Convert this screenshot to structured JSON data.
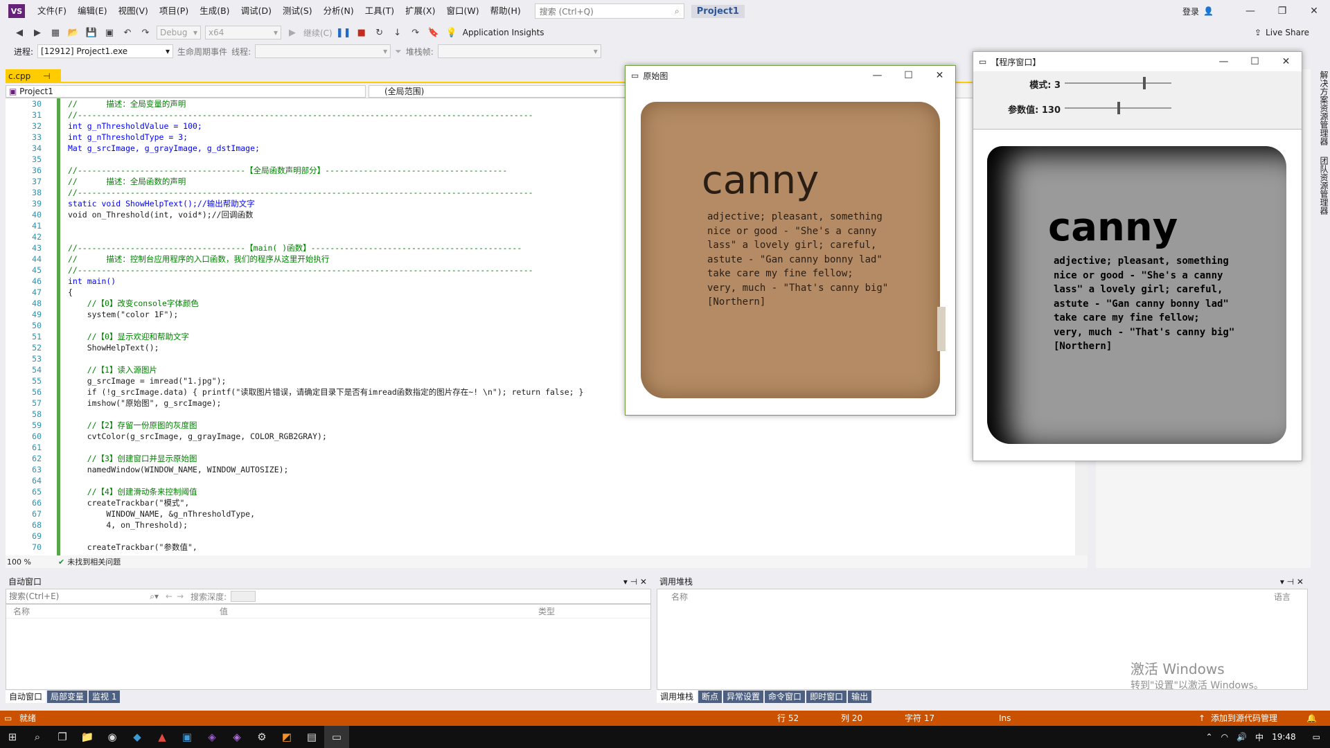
{
  "titlebar": {
    "menus": [
      "文件(F)",
      "编辑(E)",
      "视图(V)",
      "项目(P)",
      "生成(B)",
      "调试(D)",
      "测试(S)",
      "分析(N)",
      "工具(T)",
      "扩展(X)",
      "窗口(W)",
      "帮助(H)"
    ],
    "search_placeholder": "搜索 (Ctrl+Q)",
    "project_name": "Project1",
    "login": "登录"
  },
  "toolbar": {
    "config": "Debug",
    "platform": "x64",
    "continue_label": "继续(C)",
    "insights": "Application Insights",
    "live_share": "Live Share"
  },
  "toolbar2": {
    "process_label": "进程:",
    "process_value": "[12912] Project1.exe",
    "lifecycle": "生命周期事件",
    "thread_label": "线程:",
    "stack_label": "堆栈帧:"
  },
  "editor": {
    "tab_name": "c.cpp",
    "nav_project": "Project1",
    "nav_scope": "(全局范围)",
    "zoom": "100 %",
    "issues": "未找到相关问题",
    "line_numbers": [
      "30",
      "31",
      "32",
      "33",
      "34",
      "35",
      "36",
      "37",
      "38",
      "39",
      "40",
      "41",
      "42",
      "43",
      "44",
      "45",
      "46",
      "47",
      "48",
      "49",
      "50",
      "51",
      "52",
      "53",
      "54",
      "55",
      "56",
      "57",
      "58",
      "59",
      "60",
      "61",
      "62",
      "63",
      "64",
      "65",
      "66",
      "67",
      "68",
      "69",
      "70"
    ],
    "lines": [
      "//      描述：全局变量的声明",
      "//-----------------------------------------------------------------------------------------------",
      "int g_nThresholdValue = 100;",
      "int g_nThresholdType = 3;",
      "Mat g_srcImage, g_grayImage, g_dstImage;",
      "",
      "//-----------------------------------【全局函数声明部分】--------------------------------------",
      "//      描述：全局函数的声明",
      "//-----------------------------------------------------------------------------------------------",
      "static void ShowHelpText();//输出帮助文字",
      "void on_Threshold(int, void*);//回调函数",
      "",
      "",
      "//-----------------------------------【main( )函数】--------------------------------------------",
      "//      描述：控制台应用程序的入口函数，我们的程序从这里开始执行",
      "//-----------------------------------------------------------------------------------------------",
      "int main()",
      "{",
      "    //【0】改变console字体颜色",
      "    system(\"color 1F\");",
      "",
      "    //【0】显示欢迎和帮助文字",
      "    ShowHelpText();",
      "",
      "    //【1】读入源图片",
      "    g_srcImage = imread(\"1.jpg\");",
      "    if (!g_srcImage.data) { printf(\"读取图片错误，请确定目录下是否有imread函数指定的图片存在~! \\n\"); return false; }",
      "    imshow(\"原始图\", g_srcImage);",
      "",
      "    //【2】存留一份原图的灰度图",
      "    cvtColor(g_srcImage, g_grayImage, COLOR_RGB2GRAY);",
      "",
      "    //【3】创建窗口并显示原始图",
      "    namedWindow(WINDOW_NAME, WINDOW_AUTOSIZE);",
      "",
      "    //【4】创建滑动条来控制阈值",
      "    createTrackbar(\"模式\",",
      "        WINDOW_NAME, &g_nThresholdType,",
      "        4, on_Threshold);",
      "",
      "    createTrackbar(\"参数值\","
    ]
  },
  "original_window": {
    "title": "原始图",
    "pillow_heading": "canny",
    "pillow_body": "adjective; pleasant, something\nnice or good - \"She's a canny\nlass\" a lovely girl; careful,\nastute - \"Gan canny bonny lad\"\ntake care my fine fellow;\nvery, much - \"That's canny big\"\n[Northern]"
  },
  "program_window": {
    "title": "【程序窗口】",
    "trackbar_mode": "模式: 3",
    "trackbar_param": "参数值: 130",
    "mode_value": 3,
    "mode_max": 4,
    "param_value": 130,
    "param_max": 255
  },
  "auto_window": {
    "title": "自动窗口",
    "search_placeholder": "搜索(Ctrl+E)",
    "depth_label": "搜索深度:",
    "col_name": "名称",
    "col_value": "值",
    "col_type": "类型",
    "tabs": [
      "自动窗口",
      "局部变量",
      "监视 1"
    ]
  },
  "callstack_window": {
    "title": "调用堆栈",
    "col_name": "名称",
    "col_lang": "语言",
    "tabs": [
      "调用堆栈",
      "断点",
      "异常设置",
      "命令窗口",
      "即时窗口",
      "输出"
    ]
  },
  "watermark": {
    "line1": "激活 Windows",
    "line2": "转到\"设置\"以激活 Windows。"
  },
  "statusbar": {
    "ready": "就绪",
    "row": "行 52",
    "col": "列 20",
    "char": "字符 17",
    "ins": "Ins",
    "source_control": "添加到源代码管理"
  },
  "right_vtabs": [
    "解决方案资源管理器",
    "团队资源管理器"
  ],
  "taskbar": {
    "time": "19:48",
    "lang": "中"
  },
  "colors": {
    "accent": "#68217a",
    "statusbar": "#ca5100",
    "tab_active": "#ffcc00"
  }
}
